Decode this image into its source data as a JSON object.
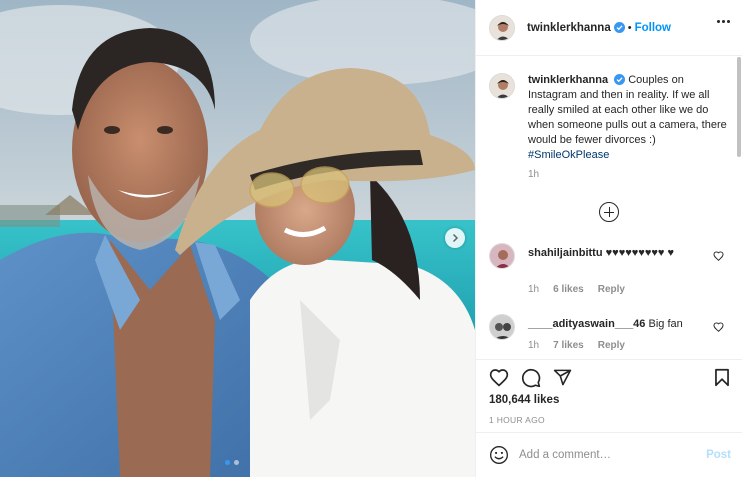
{
  "header": {
    "username": "twinklerkhanna",
    "separator": "•",
    "follow_label": "Follow"
  },
  "caption": {
    "username": "twinklerkhanna",
    "text": "Couples on Instagram and then in reality. If we all really smiled at each other like we do when someone pulls out a camera, there would be fewer divorces :)",
    "hashtag": "#SmileOkPlease",
    "time": "1h"
  },
  "comments": [
    {
      "username": "shahiljainbittu",
      "text": "♥♥♥♥♥♥♥♥♥ ♥",
      "time": "1h",
      "likes": "6 likes",
      "reply": "Reply"
    },
    {
      "username": "____adityaswain___46",
      "text": "Big fan",
      "time": "1h",
      "likes": "7 likes",
      "reply": "Reply"
    }
  ],
  "post": {
    "likes_count": "180,644 likes",
    "time_ago": "1 HOUR AGO",
    "carousel_index": 1,
    "carousel_total": 2
  },
  "add_comment": {
    "placeholder": "Add a comment…",
    "post_label": "Post"
  },
  "icons": {
    "verified": "verified-badge-icon",
    "more": "more-options-icon",
    "heart": "heart-icon",
    "comment": "comment-icon",
    "share": "share-icon",
    "save": "bookmark-icon",
    "emoji": "emoji-icon",
    "load_more": "plus-circle-icon",
    "next": "chevron-right-icon"
  },
  "colors": {
    "accent": "#0095f6",
    "verified": "#3897f0",
    "post_disabled": "#b2dffc"
  }
}
